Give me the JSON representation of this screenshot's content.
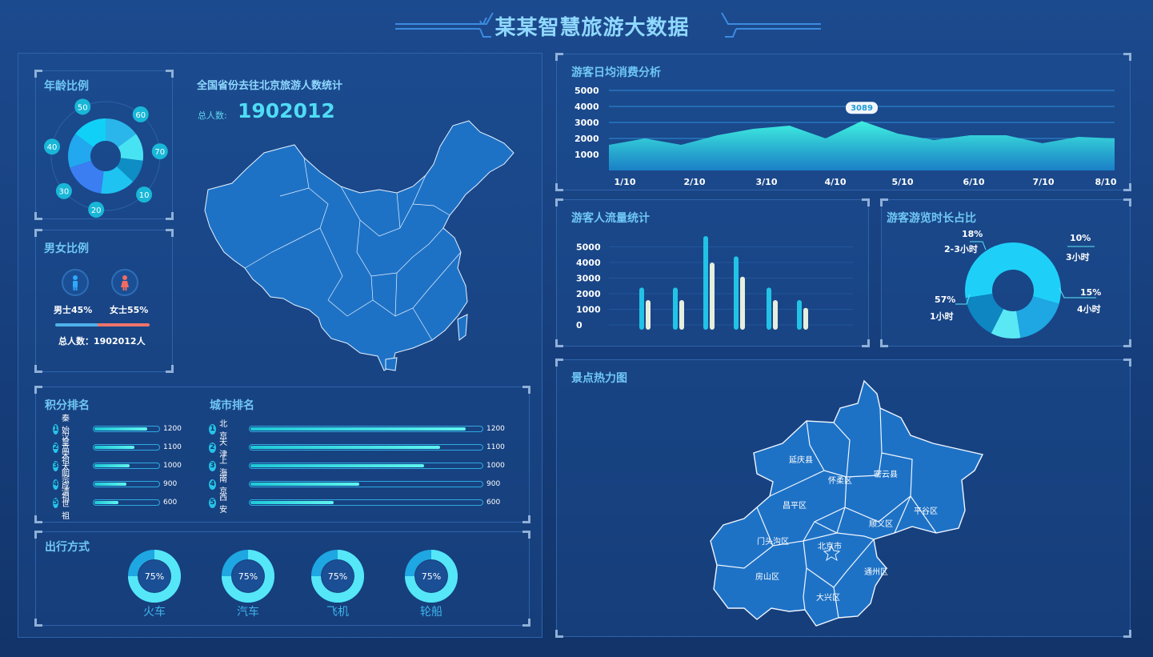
{
  "header": {
    "title": "某某智慧旅游大数据"
  },
  "age": {
    "title": "年龄比例",
    "labels": [
      "50",
      "60",
      "70",
      "10",
      "20",
      "30",
      "40"
    ],
    "slices": [
      {
        "value": 15,
        "color": "#2ab6ea"
      },
      {
        "value": 12,
        "color": "#48e3f3"
      },
      {
        "value": 10,
        "color": "#0e8ec4"
      },
      {
        "value": 15,
        "color": "#1ec3f2"
      },
      {
        "value": 18,
        "color": "#3a7ef2"
      },
      {
        "value": 15,
        "color": "#22a8ee"
      },
      {
        "value": 15,
        "color": "#10d0f8"
      }
    ]
  },
  "gender": {
    "title": "男女比例",
    "male": "男士45%",
    "female": "女士55%",
    "male_pct": 45,
    "total_label": "总人数：1902012人",
    "male_color": "#4fb3ea",
    "female_color": "#f0736a"
  },
  "national": {
    "title": "全国省份去往北京旅游人数统计",
    "total_label": "总人数:",
    "total_value": "1902012"
  },
  "score_rank": {
    "title": "积分排名",
    "items": [
      {
        "num": "1",
        "name": "秦始皇",
        "value": "1200",
        "pct": 83
      },
      {
        "num": "2",
        "name": "汉高祖",
        "value": "1100",
        "pct": 63
      },
      {
        "num": "3",
        "name": "宋太宗",
        "value": "1000",
        "pct": 55
      },
      {
        "num": "4",
        "name": "明成祖",
        "value": "900",
        "pct": 50
      },
      {
        "num": "5",
        "name": "清世祖",
        "value": "600",
        "pct": 38
      }
    ]
  },
  "city_rank": {
    "title": "城市排名",
    "items": [
      {
        "num": "1",
        "name": "北京",
        "value": "1200",
        "pct": 93
      },
      {
        "num": "2",
        "name": "天津",
        "value": "1100",
        "pct": 82
      },
      {
        "num": "3",
        "name": "上海",
        "value": "1000",
        "pct": 75
      },
      {
        "num": "4",
        "name": "南京",
        "value": "900",
        "pct": 47
      },
      {
        "num": "5",
        "name": "西安",
        "value": "600",
        "pct": 36
      }
    ]
  },
  "travel": {
    "title": "出行方式",
    "items": [
      {
        "label": "火车",
        "pct_label": "75%",
        "pct": 75
      },
      {
        "label": "汽车",
        "pct_label": "75%",
        "pct": 75
      },
      {
        "label": "飞机",
        "pct_label": "75%",
        "pct": 75
      },
      {
        "label": "轮船",
        "pct_label": "75%",
        "pct": 75
      }
    ]
  },
  "spend": {
    "title": "游客日均消费分析",
    "tooltip": "3089"
  },
  "flow": {
    "title": "游客人流量统计"
  },
  "duration": {
    "title": "游客游览时长占比"
  },
  "heat": {
    "title": "景点热力图",
    "districts": [
      "延庆县",
      "怀柔区",
      "密云县",
      "昌平区",
      "顺义区",
      "平谷区",
      "门头沟区",
      "北京市",
      "通州区",
      "房山区",
      "大兴区"
    ]
  },
  "chart_data": [
    {
      "type": "area",
      "title": "游客日均消费分析",
      "x": [
        "1/10",
        "",
        "2/10",
        "",
        "3/10",
        "",
        "4/10",
        "",
        "5/10",
        "",
        "6/10",
        "",
        "7/10",
        "",
        "8/10"
      ],
      "values": [
        1600,
        2000,
        1600,
        2200,
        2600,
        2800,
        2000,
        3089,
        2300,
        1900,
        2200,
        2200,
        1700,
        2100,
        2000
      ],
      "ylim": [
        0,
        5000
      ],
      "yticks": [
        "5000",
        "4000",
        "3000",
        "2000",
        "1000"
      ],
      "xticks": [
        "1/10",
        "2/10",
        "3/10",
        "4/10",
        "5/10",
        "6/10",
        "7/10",
        "8/10"
      ],
      "highlight_value": 3089
    },
    {
      "type": "bar",
      "title": "游客人流量统计",
      "categories": [
        "",
        "",
        "",
        "",
        "",
        ""
      ],
      "series": [
        {
          "values": [
            2700,
            2700,
            6000,
            4700,
            2700,
            1900
          ],
          "color": "#22c3e6"
        },
        {
          "values": [
            1900,
            1900,
            4300,
            3400,
            1900,
            1400
          ],
          "color": "#e6eedd"
        }
      ],
      "ylim": [
        0,
        6000
      ],
      "yticks": [
        "5000",
        "4000",
        "3000",
        "2000",
        "1000",
        "0"
      ]
    },
    {
      "type": "pie",
      "title": "游客游览时长占比",
      "slices": [
        {
          "label": "1小时",
          "pct_label": "57%",
          "value": 57,
          "color": "#1ed0f8"
        },
        {
          "label": "2-3小时",
          "pct_label": "18%",
          "value": 18,
          "color": "#1ea7e2"
        },
        {
          "label": "3小时",
          "pct_label": "10%",
          "value": 10,
          "color": "#5ae8f5"
        },
        {
          "label": "4小时",
          "pct_label": "15%",
          "value": 15,
          "color": "#0d86c2"
        }
      ]
    }
  ]
}
